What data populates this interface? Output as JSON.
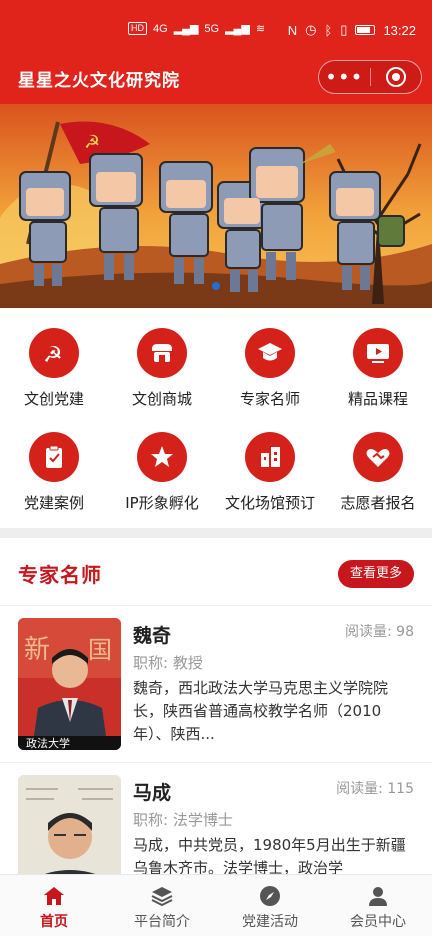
{
  "status_bar": {
    "hd": "HD",
    "net1": "4G",
    "net2": "5G",
    "time": "13:22"
  },
  "app": {
    "title": "星星之火文化研究院",
    "menu_dots": "•••"
  },
  "banner": {
    "alt": ""
  },
  "grid": {
    "items": [
      {
        "label": "文创党建",
        "icon": "hammer-sickle-icon"
      },
      {
        "label": "文创商城",
        "icon": "shop-icon"
      },
      {
        "label": "专家名师",
        "icon": "graduation-cap-icon"
      },
      {
        "label": "精品课程",
        "icon": "video-play-icon"
      },
      {
        "label": "党建案例",
        "icon": "clipboard-check-icon"
      },
      {
        "label": "IP形象孵化",
        "icon": "star-icon"
      },
      {
        "label": "文化场馆预订",
        "icon": "building-icon"
      },
      {
        "label": "志愿者报名",
        "icon": "heart-handshake-icon"
      }
    ]
  },
  "section": {
    "title": "专家名师",
    "more": "查看更多"
  },
  "experts": [
    {
      "name": "魏奇",
      "reads": "阅读量: 98",
      "title": "职称: 教授",
      "desc": "魏奇，西北政法大学马克思主义学院院长，陕西省普通高校教学名师（2010年）、陕西..."
    },
    {
      "name": "马成",
      "reads": "阅读量: 115",
      "title": "职称: 法学博士",
      "desc": "马成，中共党员，1980年5月出生于新疆乌鲁木齐市。法学博士，政治学"
    }
  ],
  "tabs": [
    {
      "label": "首页",
      "icon": "home-icon",
      "active": true
    },
    {
      "label": "平台简介",
      "icon": "layers-icon",
      "active": false
    },
    {
      "label": "党建活动",
      "icon": "compass-icon",
      "active": false
    },
    {
      "label": "会员中心",
      "icon": "user-icon",
      "active": false
    }
  ],
  "colors": {
    "brand": "#e0241c",
    "accent": "#c8161d"
  }
}
